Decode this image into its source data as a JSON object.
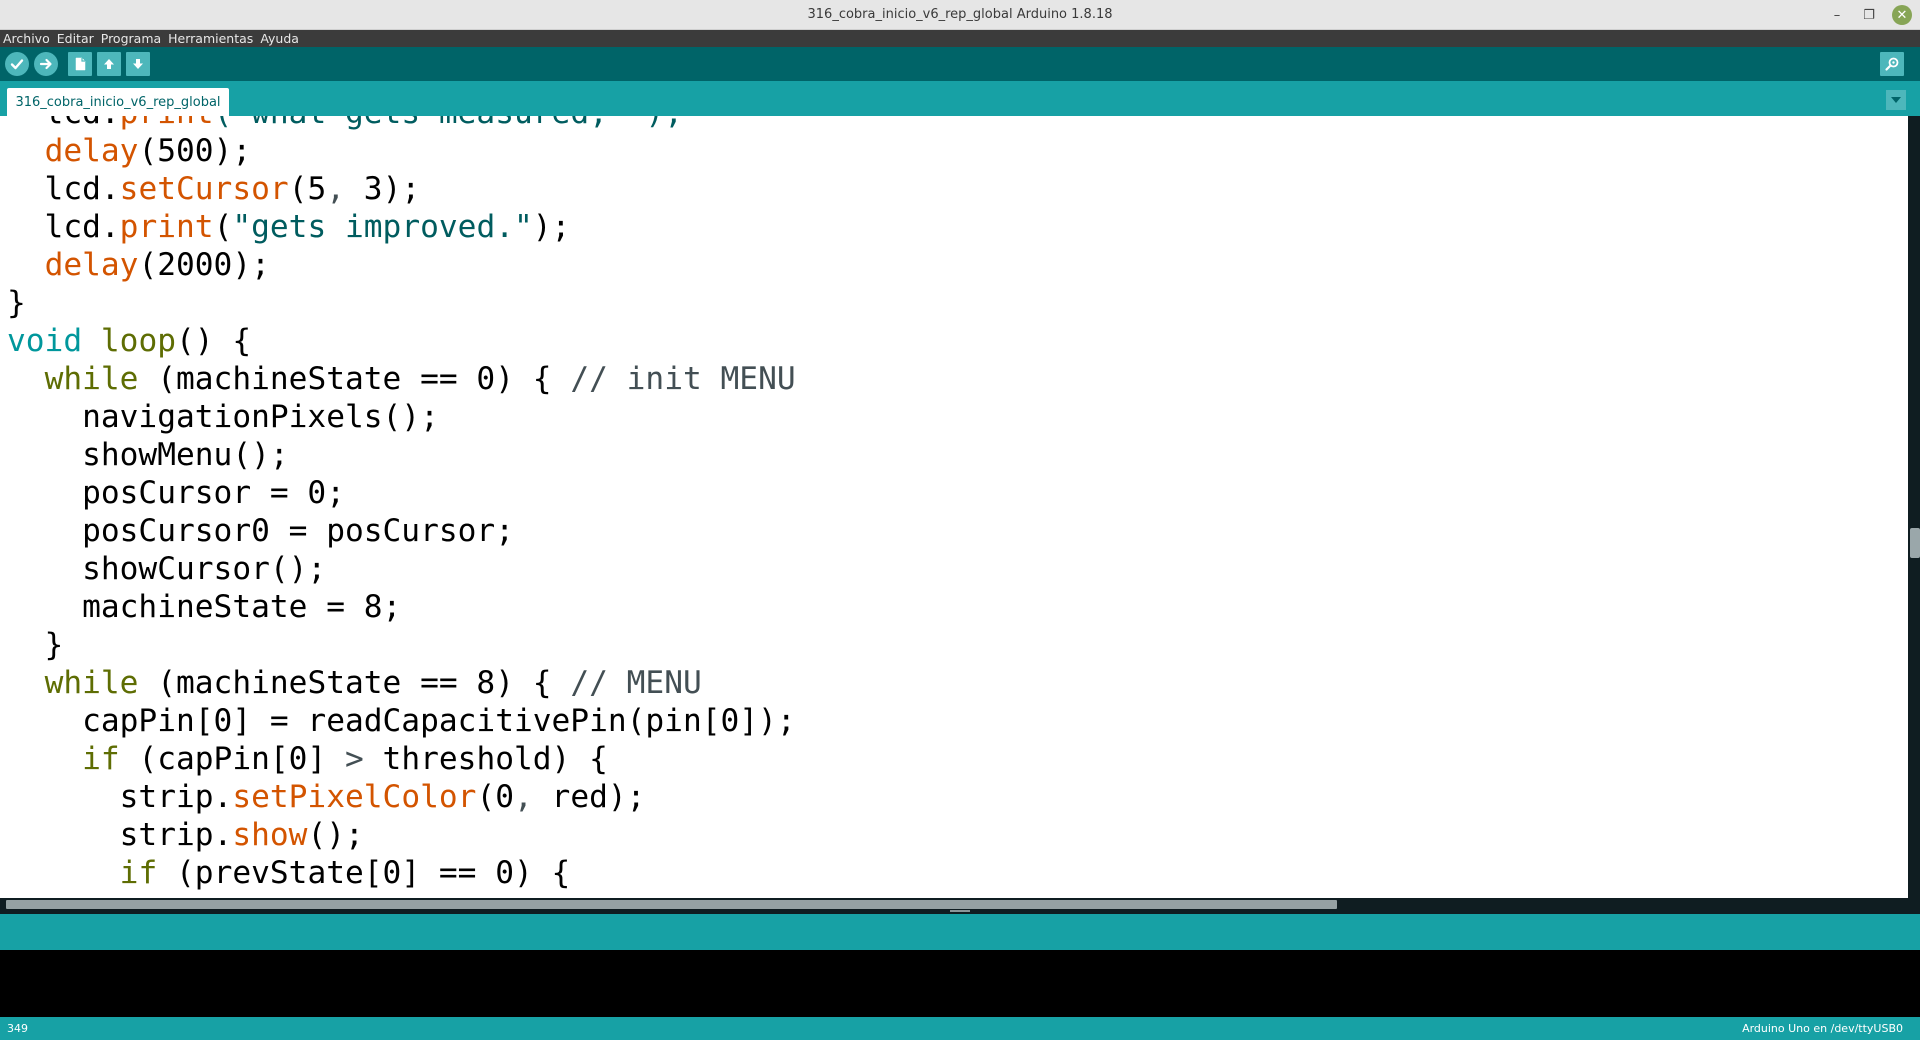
{
  "window": {
    "title": "316_cobra_inicio_v6_rep_global Arduino 1.8.18",
    "minimize_glyph": "–",
    "maximize_glyph": "❐",
    "close_glyph": "✕"
  },
  "menubar": {
    "items": [
      "Archivo",
      "Editar",
      "Programa",
      "Herramientas",
      "Ayuda"
    ]
  },
  "toolbar": {
    "buttons": [
      "verify-icon",
      "upload-icon",
      "new-icon",
      "open-icon",
      "save-icon"
    ],
    "right_button": "serial-monitor-icon"
  },
  "tabs": {
    "active": "316_cobra_inicio_v6_rep_global",
    "menu_icon": "tab-menu-chevron-icon"
  },
  "editor": {
    "lines": [
      [
        {
          "t": "  lcd.",
          "c": ""
        },
        {
          "t": "print",
          "c": "fn"
        },
        {
          "t": "(\"what gets measured, \");",
          "c": "str"
        }
      ],
      [
        {
          "t": "  ",
          "c": ""
        },
        {
          "t": "delay",
          "c": "fn"
        },
        {
          "t": "(500);",
          "c": ""
        }
      ],
      [
        {
          "t": "  lcd.",
          "c": ""
        },
        {
          "t": "setCursor",
          "c": "fn"
        },
        {
          "t": "(5",
          "c": ""
        },
        {
          "t": ",",
          "c": "op"
        },
        {
          "t": " 3);",
          "c": ""
        }
      ],
      [
        {
          "t": "  lcd.",
          "c": ""
        },
        {
          "t": "print",
          "c": "fn"
        },
        {
          "t": "(",
          "c": ""
        },
        {
          "t": "\"gets improved.\"",
          "c": "str"
        },
        {
          "t": ");",
          "c": ""
        }
      ],
      [
        {
          "t": "  ",
          "c": ""
        },
        {
          "t": "delay",
          "c": "fn"
        },
        {
          "t": "(2000);",
          "c": ""
        }
      ],
      [
        {
          "t": "}",
          "c": ""
        }
      ],
      [
        {
          "t": "void",
          "c": "kt"
        },
        {
          "t": " ",
          "c": ""
        },
        {
          "t": "loop",
          "c": "kw"
        },
        {
          "t": "() {",
          "c": ""
        }
      ],
      [
        {
          "t": "  ",
          "c": ""
        },
        {
          "t": "while",
          "c": "kw"
        },
        {
          "t": " (machineState == 0) { ",
          "c": ""
        },
        {
          "t": "// init MENU",
          "c": "cm"
        }
      ],
      [
        {
          "t": "    navigationPixels();",
          "c": ""
        }
      ],
      [
        {
          "t": "    showMenu();",
          "c": ""
        }
      ],
      [
        {
          "t": "    posCursor = 0;",
          "c": ""
        }
      ],
      [
        {
          "t": "    posCursor0 = posCursor;",
          "c": ""
        }
      ],
      [
        {
          "t": "    showCursor();",
          "c": ""
        }
      ],
      [
        {
          "t": "    machineState = 8;",
          "c": ""
        }
      ],
      [
        {
          "t": "  }",
          "c": ""
        }
      ],
      [
        {
          "t": "  ",
          "c": ""
        },
        {
          "t": "while",
          "c": "kw"
        },
        {
          "t": " (machineState == 8) { ",
          "c": ""
        },
        {
          "t": "// MENU",
          "c": "cm"
        }
      ],
      [
        {
          "t": "    capPin[0] = readCapacitivePin(pin[0]);",
          "c": ""
        }
      ],
      [
        {
          "t": "    ",
          "c": ""
        },
        {
          "t": "if",
          "c": "kw"
        },
        {
          "t": " (capPin[0] ",
          "c": ""
        },
        {
          "t": ">",
          "c": "op"
        },
        {
          "t": " threshold) {",
          "c": ""
        }
      ],
      [
        {
          "t": "      strip.",
          "c": ""
        },
        {
          "t": "setPixelColor",
          "c": "fn"
        },
        {
          "t": "(0",
          "c": ""
        },
        {
          "t": ",",
          "c": "op"
        },
        {
          "t": " red);",
          "c": ""
        }
      ],
      [
        {
          "t": "      strip.",
          "c": ""
        },
        {
          "t": "show",
          "c": "fn"
        },
        {
          "t": "();",
          "c": ""
        }
      ],
      [
        {
          "t": "      ",
          "c": ""
        },
        {
          "t": "if",
          "c": "kw"
        },
        {
          "t": " (prevState[0] == 0) {",
          "c": ""
        }
      ]
    ]
  },
  "status": {
    "line_number": "349",
    "board": "Arduino Uno en /dev/ttyUSB0"
  },
  "colors": {
    "toolbar": "#006468",
    "tabbar": "#17a1a5",
    "button": "#4db7bb",
    "keyword": "#5e6d03",
    "type": "#00979c",
    "function": "#d35400",
    "string": "#005c5f",
    "comment": "#434f54"
  }
}
